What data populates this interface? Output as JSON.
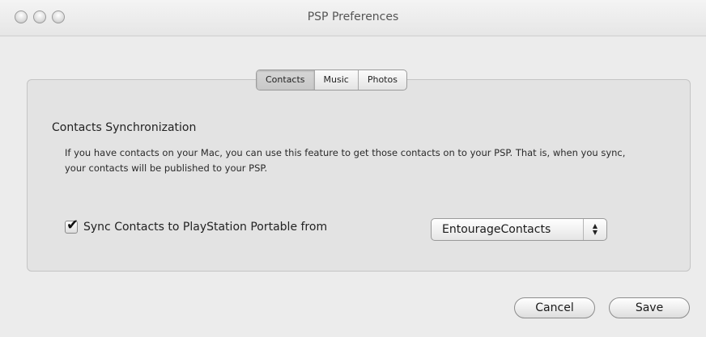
{
  "window": {
    "title": "PSP Preferences"
  },
  "tabs": [
    {
      "label": "Contacts",
      "active": true
    },
    {
      "label": "Music",
      "active": false
    },
    {
      "label": "Photos",
      "active": false
    }
  ],
  "contacts": {
    "section_title": "Contacts Synchronization",
    "description": "If you have contacts on your Mac, you can use this feature to get those contacts on to your PSP. That is, when you sync, your contacts will be published to your PSP.",
    "sync_checkbox": {
      "label": "Sync Contacts to PlayStation Portable from",
      "checked": true,
      "check_glyph": "✔"
    },
    "source_popup": {
      "value": "EntourageContacts",
      "arrow_up": "▲",
      "arrow_down": "▼"
    }
  },
  "buttons": {
    "cancel_label": "Cancel",
    "save_label": "Save"
  }
}
